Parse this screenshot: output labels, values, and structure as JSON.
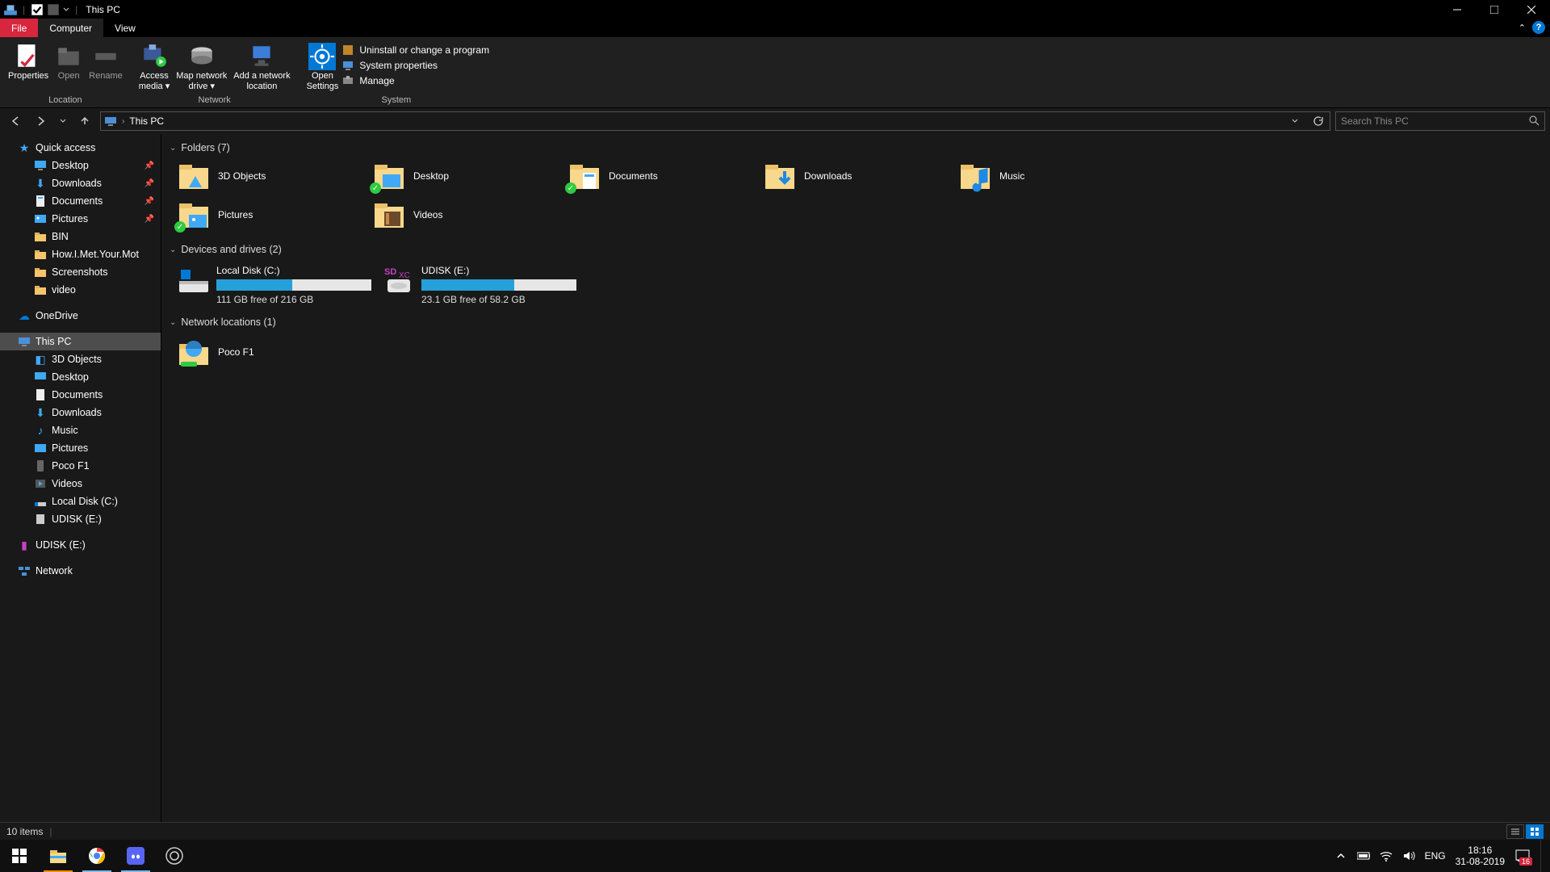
{
  "titlebar": {
    "title": "This PC"
  },
  "ribbon": {
    "tabs": {
      "file": "File",
      "computer": "Computer",
      "view": "View"
    },
    "location": {
      "group": "Location",
      "properties": "Properties",
      "open": "Open",
      "rename": "Rename"
    },
    "network": {
      "group": "Network",
      "access_media": "Access\nmedia ▾",
      "map_drive": "Map network\ndrive ▾",
      "add_location": "Add a network\nlocation"
    },
    "system": {
      "group": "System",
      "open_settings": "Open\nSettings",
      "uninstall": "Uninstall or change a program",
      "properties": "System properties",
      "manage": "Manage"
    }
  },
  "address": {
    "crumb1": "This PC",
    "search_placeholder": "Search This PC"
  },
  "tree": {
    "quick_access": "Quick access",
    "desktop": "Desktop",
    "downloads": "Downloads",
    "documents": "Documents",
    "pictures": "Pictures",
    "bin": "BIN",
    "himym": "How.I.Met.Your.Mot",
    "screenshots": "Screenshots",
    "video": "video",
    "onedrive": "OneDrive",
    "this_pc": "This PC",
    "objects3d": "3D Objects",
    "desktop2": "Desktop",
    "documents2": "Documents",
    "downloads2": "Downloads",
    "music": "Music",
    "pictures2": "Pictures",
    "pocof1": "Poco F1",
    "videos": "Videos",
    "localdisk": "Local Disk (C:)",
    "udisk": "UDISK (E:)",
    "udisk2": "UDISK (E:)",
    "network": "Network"
  },
  "groups": {
    "folders": "Folders (7)",
    "drives": "Devices and drives (2)",
    "netloc": "Network locations (1)"
  },
  "folders": {
    "objects3d": "3D Objects",
    "desktop": "Desktop",
    "documents": "Documents",
    "downloads": "Downloads",
    "music": "Music",
    "pictures": "Pictures",
    "videos": "Videos"
  },
  "drives": {
    "c": {
      "name": "Local Disk (C:)",
      "free": "111 GB free of 216 GB",
      "fill_pct": 49
    },
    "e": {
      "name": "UDISK (E:)",
      "free": "23.1 GB free of 58.2 GB",
      "fill_pct": 60
    }
  },
  "netloc": {
    "poco": "Poco F1"
  },
  "status": {
    "items": "10 items"
  },
  "tray": {
    "lang": "ENG",
    "time": "18:16",
    "date": "31-08-2019",
    "notif_count": "16"
  }
}
